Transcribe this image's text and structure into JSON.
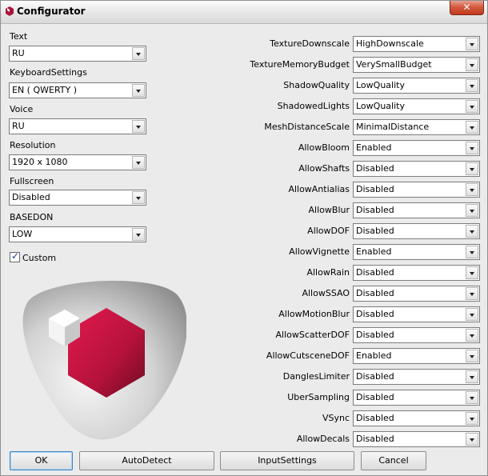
{
  "window": {
    "title": "Configurator",
    "close_glyph": "✕",
    "close_color": "#c6391c"
  },
  "left_settings": [
    {
      "label": "Text",
      "value": "RU"
    },
    {
      "label": "KeyboardSettings",
      "value": "EN ( QWERTY )"
    },
    {
      "label": "Voice",
      "value": "RU"
    },
    {
      "label": "Resolution",
      "value": "1920 x 1080"
    },
    {
      "label": "Fullscreen",
      "value": "Disabled"
    },
    {
      "label": "BASEDON",
      "value": "LOW"
    }
  ],
  "custom_checkbox": {
    "label": "Custom",
    "checked": true,
    "check_glyph": "✓"
  },
  "right_settings": [
    {
      "label": "TextureDownscale",
      "value": "HighDownscale"
    },
    {
      "label": "TextureMemoryBudget",
      "value": "VerySmallBudget"
    },
    {
      "label": "ShadowQuality",
      "value": "LowQuality"
    },
    {
      "label": "ShadowedLights",
      "value": "LowQuality"
    },
    {
      "label": "MeshDistanceScale",
      "value": "MinimalDistance"
    },
    {
      "label": "AllowBloom",
      "value": "Enabled"
    },
    {
      "label": "AllowShafts",
      "value": "Disabled"
    },
    {
      "label": "AllowAntialias",
      "value": "Disabled"
    },
    {
      "label": "AllowBlur",
      "value": "Disabled"
    },
    {
      "label": "AllowDOF",
      "value": "Disabled"
    },
    {
      "label": "AllowVignette",
      "value": "Enabled"
    },
    {
      "label": "AllowRain",
      "value": "Disabled"
    },
    {
      "label": "AllowSSAO",
      "value": "Disabled"
    },
    {
      "label": "AllowMotionBlur",
      "value": "Disabled"
    },
    {
      "label": "AllowScatterDOF",
      "value": "Disabled"
    },
    {
      "label": "AllowCutsceneDOF",
      "value": "Enabled"
    },
    {
      "label": "DanglesLimiter",
      "value": "Disabled"
    },
    {
      "label": "UberSampling",
      "value": "Disabled"
    },
    {
      "label": "VSync",
      "value": "Disabled"
    },
    {
      "label": "AllowDecals",
      "value": "Disabled"
    }
  ],
  "buttons": {
    "ok": "OK",
    "autodetect": "AutoDetect",
    "inputsettings": "InputSettings",
    "cancel": "Cancel"
  },
  "logo": {
    "accent": "#b8143c",
    "icon": "hexagon-cube-logo"
  }
}
